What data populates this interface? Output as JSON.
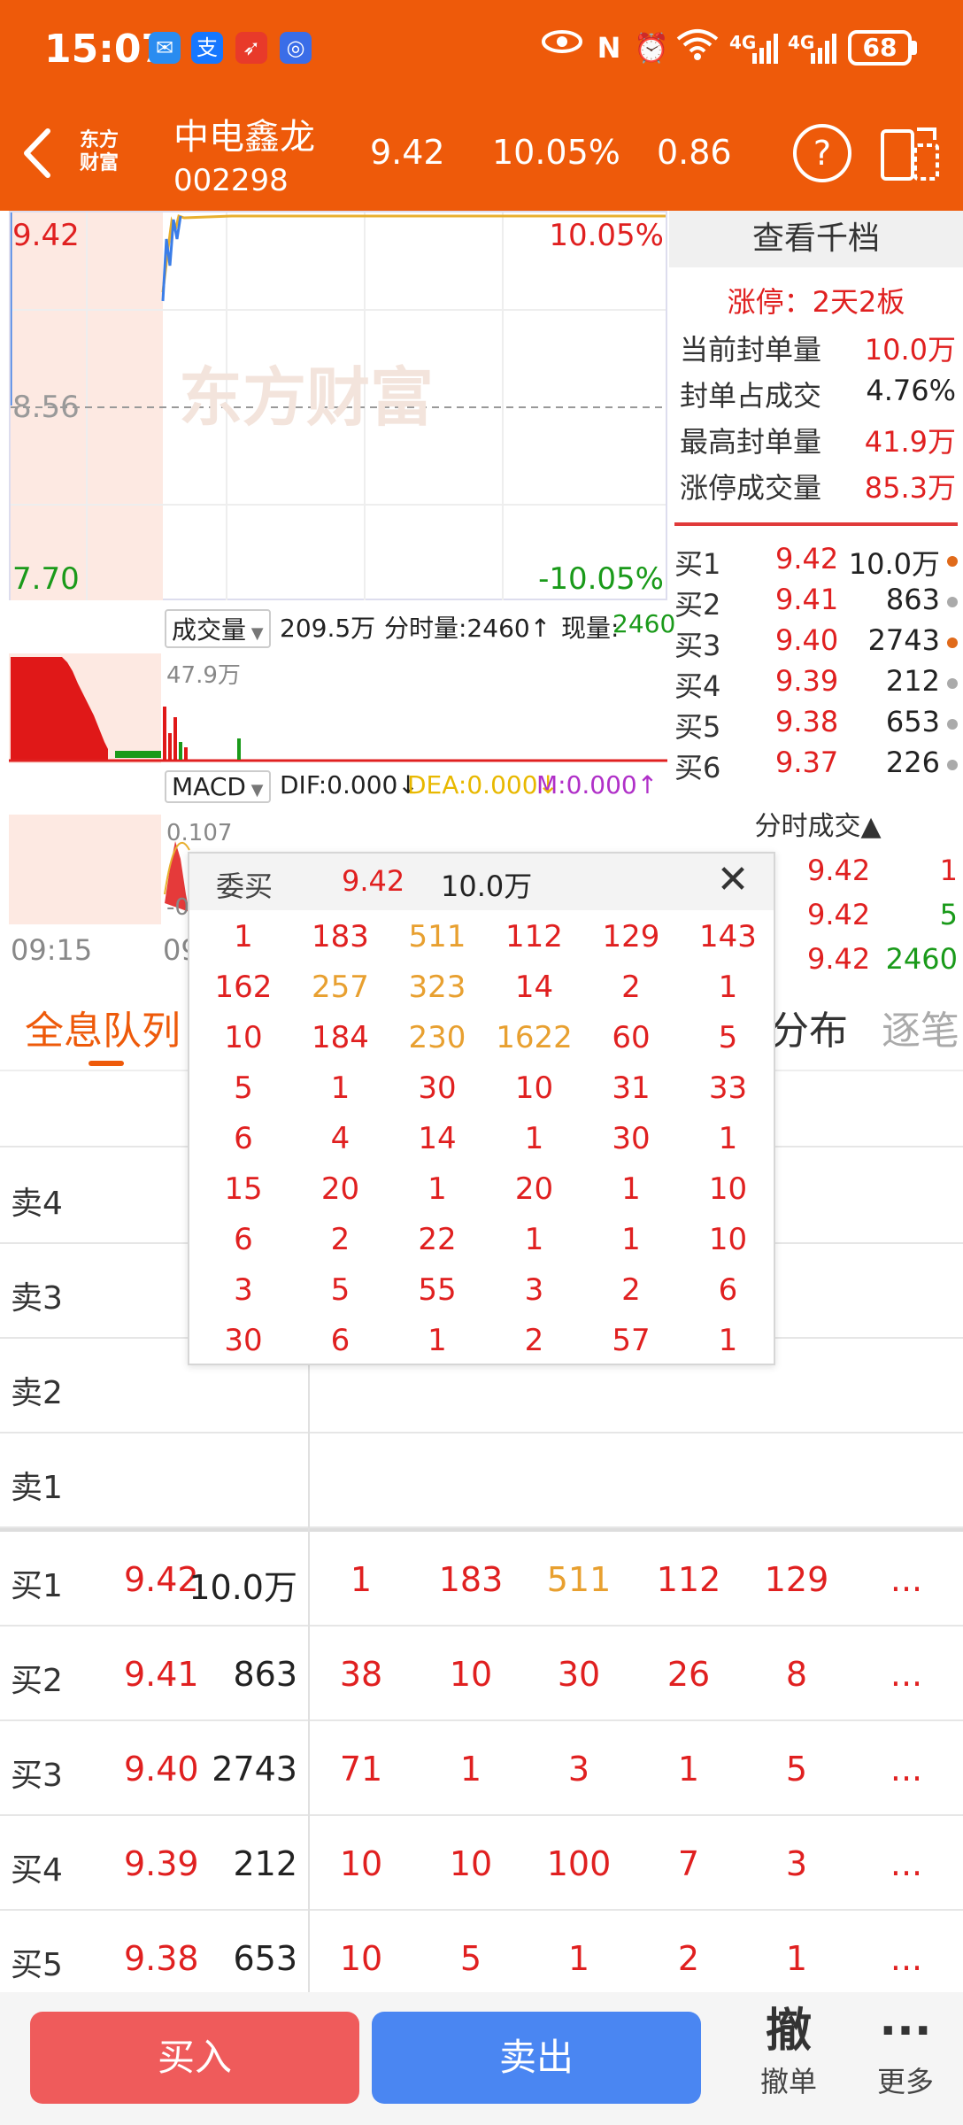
{
  "status_bar": {
    "time": "15:07",
    "net_1": "4G",
    "net_2": "4G",
    "battery": "68"
  },
  "header": {
    "logo_line1": "东方",
    "logo_line2": "财富",
    "stock_name": "中电鑫龙",
    "stock_code": "002298",
    "price": "9.42",
    "change_pct": "10.05%",
    "change": "0.86",
    "help": "?"
  },
  "chart": {
    "watermark": "东方财富",
    "high_price": "9.42",
    "high_pct": "10.05%",
    "mid_price": "8.56",
    "low_price": "7.70",
    "low_pct": "-10.05%",
    "volume_selector": "成交量",
    "total_volume": "209.5万",
    "minute_volume": "分时量:2460↑",
    "current_label": "现量:",
    "current_value": "2460",
    "vol_max": "47.9万",
    "macd_selector": "MACD",
    "dif": "DIF:0.000↓",
    "dea": "DEA:0.000↓",
    "m": "M:0.000↑",
    "macd_top": "0.107",
    "macd_bottom": "-0",
    "time_start": "09:15",
    "time_mid": "09"
  },
  "right_panel": {
    "title": "查看千档",
    "limit_tag": "涨停：2天2板",
    "seal": [
      {
        "label": "当前封单量",
        "value": "10.0万"
      },
      {
        "label": "封单占成交",
        "value": "4.76%"
      },
      {
        "label": "最高封单量",
        "value": "41.9万"
      },
      {
        "label": "涨停成交量",
        "value": "85.3万"
      }
    ],
    "orderbook": [
      {
        "label": "买1",
        "price": "9.42",
        "volume": "10.0万"
      },
      {
        "label": "买2",
        "price": "9.41",
        "volume": "863"
      },
      {
        "label": "买3",
        "price": "9.40",
        "volume": "2743"
      },
      {
        "label": "买4",
        "price": "9.39",
        "volume": "212"
      },
      {
        "label": "买5",
        "price": "9.38",
        "volume": "653"
      },
      {
        "label": "买6",
        "price": "9.37",
        "volume": "226"
      }
    ],
    "timesales_title": "分时成交▲",
    "timesales": [
      {
        "price": "9.42",
        "volume": "1"
      },
      {
        "price": "9.42",
        "volume": "5"
      },
      {
        "price": "9.42",
        "volume": "2460"
      }
    ]
  },
  "tabs": {
    "active": "全息队列",
    "distribution": "分布",
    "tick": "逐笔"
  },
  "queue": {
    "sell": [
      "卖4",
      "卖3",
      "卖2",
      "卖1"
    ],
    "buy": [
      {
        "label": "买1",
        "price": "9.42",
        "volume": "10.0万",
        "orders": [
          "1",
          "183",
          "511",
          "112",
          "129"
        ]
      },
      {
        "label": "买2",
        "price": "9.41",
        "volume": "863",
        "orders": [
          "38",
          "10",
          "30",
          "26",
          "8"
        ]
      },
      {
        "label": "买3",
        "price": "9.40",
        "volume": "2743",
        "orders": [
          "71",
          "1",
          "3",
          "1",
          "5"
        ]
      },
      {
        "label": "买4",
        "price": "9.39",
        "volume": "212",
        "orders": [
          "10",
          "10",
          "100",
          "7",
          "3"
        ]
      },
      {
        "label": "买5",
        "price": "9.38",
        "volume": "653",
        "orders": [
          "10",
          "5",
          "1",
          "2",
          "1"
        ]
      }
    ],
    "more": "..."
  },
  "popup": {
    "label": "委买",
    "price": "9.42",
    "volume": "10.0万",
    "close": "✕",
    "grid": [
      [
        "1",
        "183",
        "511",
        "112",
        "129",
        "143"
      ],
      [
        "162",
        "257",
        "323",
        "14",
        "2",
        "1"
      ],
      [
        "10",
        "184",
        "230",
        "1622",
        "60",
        "5"
      ],
      [
        "5",
        "1",
        "30",
        "10",
        "31",
        "33"
      ],
      [
        "6",
        "4",
        "14",
        "1",
        "30",
        "1"
      ],
      [
        "15",
        "20",
        "1",
        "20",
        "1",
        "10"
      ],
      [
        "6",
        "2",
        "22",
        "1",
        "1",
        "10"
      ],
      [
        "3",
        "5",
        "55",
        "3",
        "2",
        "6"
      ],
      [
        "30",
        "6",
        "1",
        "2",
        "57",
        "1"
      ]
    ],
    "highlight_color": "#e8a030"
  },
  "bottom": {
    "buy": "买入",
    "sell": "卖出",
    "cancel_glyph": "撤",
    "cancel": "撤单",
    "more_glyph": "···",
    "more": "更多"
  },
  "colors": {
    "brand": "#ee5a0a",
    "up": "#e02020",
    "down": "#1a9a1a",
    "buy_button": "#ef5b5b",
    "sell_button": "#4a86f2"
  }
}
